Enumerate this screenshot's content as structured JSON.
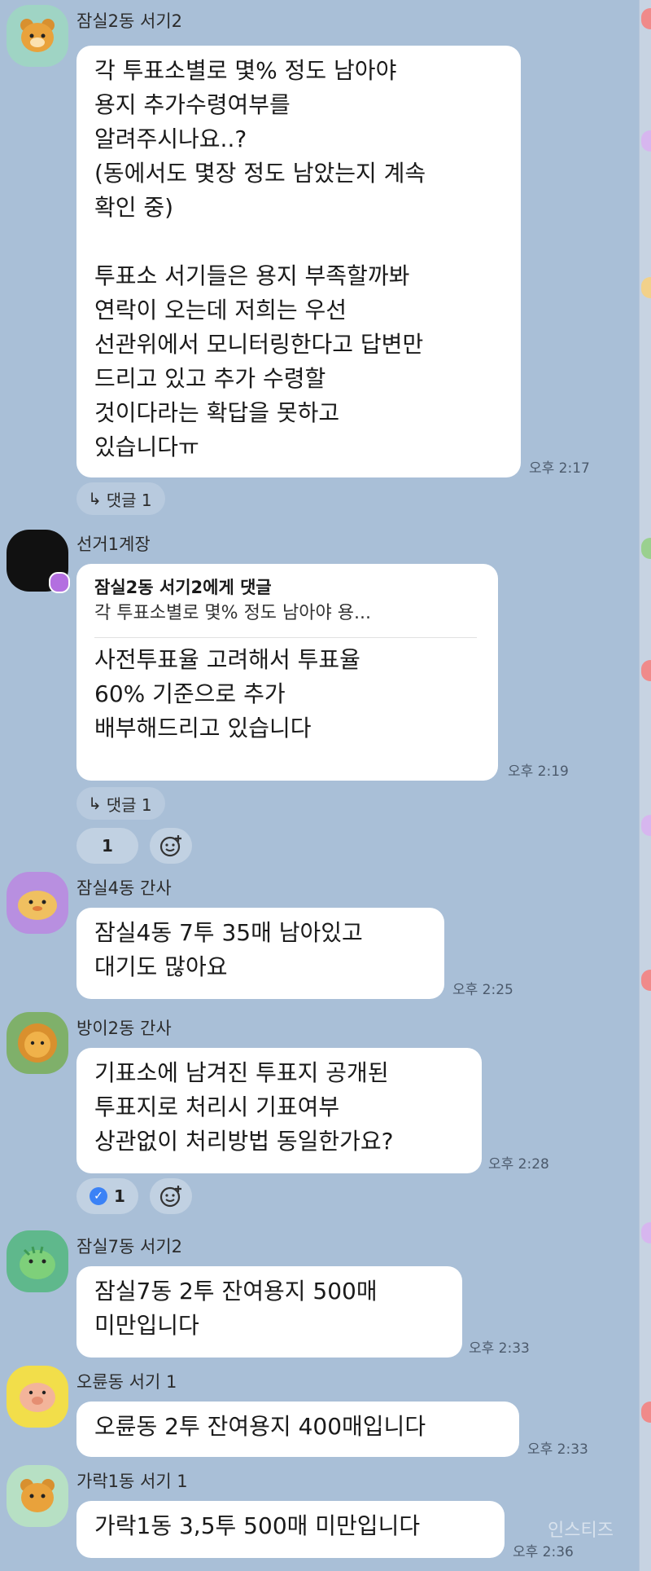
{
  "messages": [
    {
      "sender": "잠실2동 서기2",
      "text": "각 투표소별로 몇% 정도 남아야\n용지 추가수령여부를\n알려주시나요..?\n(동에서도 몇장 정도 남았는지 계속\n확인 중)\n\n투표소 서기들은 용지 부족할까봐\n연락이 오는데 저희는 우선\n선관위에서 모니터링한다고 답변만\n드리고 있고 추가 수령할\n것이다라는 확답을 못하고\n있습니다ㅠ",
      "time": "오후 2:17",
      "reply_label": "댓글 1"
    },
    {
      "sender": "선거1계장",
      "quote_title": "잠실2동 서기2에게 댓글",
      "quote_text": "각 투표소별로 몇% 정도 남아야  용...",
      "text": "사전투표율 고려해서 투표율\n60% 기준으로 추가\n배부해드리고 있습니다",
      "time": "오후 2:19",
      "reply_label": "댓글 1",
      "reaction_count": "1"
    },
    {
      "sender": "잠실4동 간사",
      "text": "잠실4동 7투 35매 남아있고\n대기도 많아요",
      "time": "오후 2:25"
    },
    {
      "sender": "방이2동 간사",
      "text": "기표소에 남겨진 투표지 공개된\n투표지로 처리시 기표여부\n상관없이 처리방법 동일한가요?",
      "time": "오후 2:28",
      "reaction_count": "1"
    },
    {
      "sender": "잠실7동 서기2",
      "text": "잠실7동 2투 잔여용지 500매\n미만입니다",
      "time": "오후 2:33"
    },
    {
      "sender": "오륜동 서기 1",
      "text": "오륜동 2투 잔여용지 400매입니다",
      "time": "오후 2:33"
    },
    {
      "sender": "가락1동 서기 1",
      "text": "가락1동 3,5투 500매 미만입니다",
      "time": "오후 2:36"
    }
  ],
  "watermark": "인스티즈",
  "colors": {
    "background": "#a9bfd7",
    "bubble": "#ffffff",
    "check_badge": "#3b82f6"
  }
}
